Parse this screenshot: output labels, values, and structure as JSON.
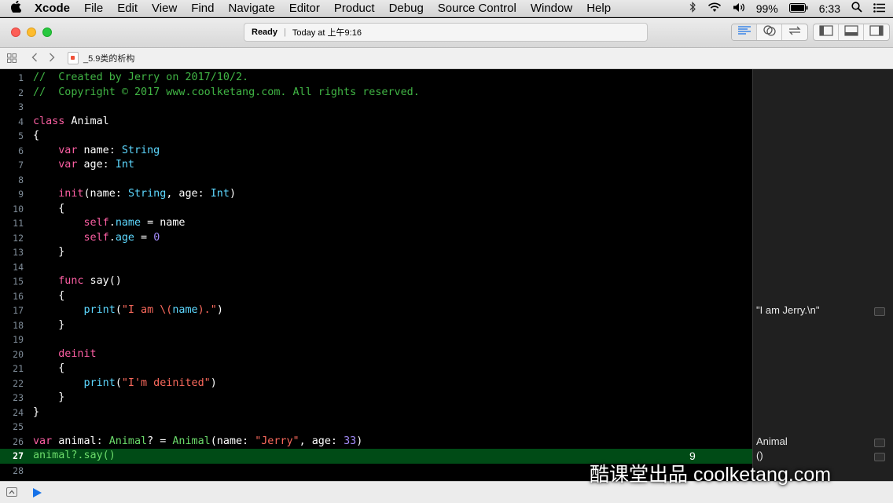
{
  "menubar": {
    "app_name": "Xcode",
    "items": [
      "File",
      "Edit",
      "View",
      "Find",
      "Navigate",
      "Editor",
      "Product",
      "Debug",
      "Source Control",
      "Window",
      "Help"
    ],
    "battery": "99%",
    "time": "6:33"
  },
  "toolbar": {
    "status_main": "Ready",
    "status_detail": "Today at 上午9:16"
  },
  "jumpbar": {
    "file": "_5.9类的析构"
  },
  "editor": {
    "highlight_line": 27,
    "highlight_value": "9",
    "line_numbers": [
      "1",
      "2",
      "3",
      "4",
      "5",
      "6",
      "7",
      "8",
      "9",
      "10",
      "11",
      "12",
      "13",
      "14",
      "15",
      "16",
      "17",
      "18",
      "19",
      "20",
      "21",
      "22",
      "23",
      "24",
      "25",
      "26",
      "27",
      "28"
    ],
    "tokens": {
      "l1": "//  Created by Jerry on 2017/10/2.",
      "l2": "//  Copyright © 2017 www.coolketang.com. All rights reserved.",
      "l4_kw": "class",
      "l4_rest": " Animal",
      "l5": "{",
      "l6_kw": "var",
      "l6_mid": " name: ",
      "l6_type": "String",
      "l7_kw": "var",
      "l7_mid": " age: ",
      "l7_type": "Int",
      "l9_kw": "init",
      "l9_a": "(name: ",
      "l9_t1": "String",
      "l9_b": ", age: ",
      "l9_t2": "Int",
      "l9_c": ")",
      "l10": "{",
      "l11_kw": "self",
      "l11_dot": ".",
      "l11_prop": "name",
      "l11_rest": " = name",
      "l12_kw": "self",
      "l12_dot": ".",
      "l12_prop": "age",
      "l12_eq": " = ",
      "l12_num": "0",
      "l13": "}",
      "l15_kw": "func",
      "l15_rest": " say()",
      "l16": "{",
      "l17_fn": "print",
      "l17_p": "(",
      "l17_s1": "\"I am \\(",
      "l17_var": "name",
      "l17_s2": ").\"",
      "l17_end": ")",
      "l18": "}",
      "l20_kw": "deinit",
      "l21": "{",
      "l22_fn": "print",
      "l22_p": "(",
      "l22_s": "\"I'm deinited\"",
      "l22_end": ")",
      "l23": "}",
      "l24": "}",
      "l26_kw": "var",
      "l26_a": " animal: ",
      "l26_t1": "Animal",
      "l26_b": "? = ",
      "l26_t2": "Animal",
      "l26_c": "(name: ",
      "l26_s": "\"Jerry\"",
      "l26_d": ", age: ",
      "l26_n": "33",
      "l26_e": ")",
      "l27": "animal?.say()"
    }
  },
  "results": {
    "r17": "\"I am Jerry.\\n\"",
    "r26": "Animal",
    "r27": "()"
  },
  "watermark": "酷课堂出品 coolketang.com",
  "colors": {
    "comment": "#41b645",
    "keyword": "#fc5fa3",
    "type": "#5dd8ff",
    "string": "#fc6a5d",
    "number": "#a48cfa",
    "highlight_line_bg": "#004b16"
  },
  "icons": [
    "apple-icon",
    "bluetooth-icon",
    "wifi-icon",
    "volume-icon",
    "battery-icon",
    "spotlight-icon",
    "notification-center-icon",
    "standard-editor-icon",
    "assistant-editor-icon",
    "version-editor-icon",
    "navigator-toggle-icon",
    "debug-area-toggle-icon",
    "utilities-toggle-icon",
    "related-items-icon",
    "back-arrow-icon",
    "forward-arrow-icon",
    "swift-file-icon",
    "debug-area-hide-icon",
    "run-playground-icon",
    "result-quicklook-icon"
  ]
}
